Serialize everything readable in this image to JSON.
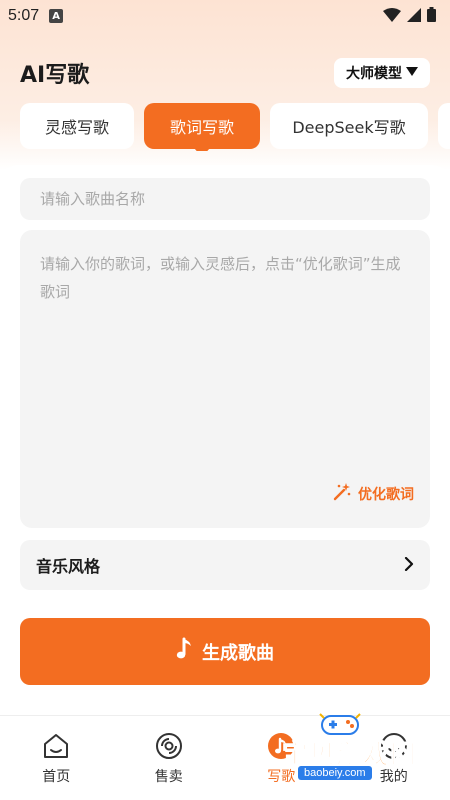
{
  "status_bar": {
    "time": "5:07",
    "notification_badge": "A"
  },
  "header": {
    "title": "AI写歌",
    "model_select": "大师模型"
  },
  "tabs": [
    {
      "label": "灵感写歌",
      "active": false
    },
    {
      "label": "歌词写歌",
      "active": true
    },
    {
      "label": "DeepSeek写歌",
      "active": false
    }
  ],
  "form": {
    "song_name_placeholder": "请输入歌曲名称",
    "song_name_value": "",
    "lyrics_placeholder": "请输入你的歌词，或输入灵感后，点击“优化歌词”生成歌词",
    "lyrics_value": "",
    "optimize_label": "优化歌词",
    "style_label": "音乐风格",
    "generate_label": "生成歌曲"
  },
  "bottom_nav": [
    {
      "label": "首页",
      "icon": "home-icon",
      "active": false
    },
    {
      "label": "售卖",
      "icon": "disc-icon",
      "active": false
    },
    {
      "label": "写歌",
      "icon": "music-note-icon",
      "active": true
    },
    {
      "label": "我的",
      "icon": "profile-icon",
      "active": false
    }
  ],
  "watermark": {
    "text": "宝贝游戏网",
    "url": "baobeiy.com"
  },
  "colors": {
    "accent": "#f36d21",
    "background_top": "#fde3d3",
    "input_bg": "#f4f4f4"
  }
}
